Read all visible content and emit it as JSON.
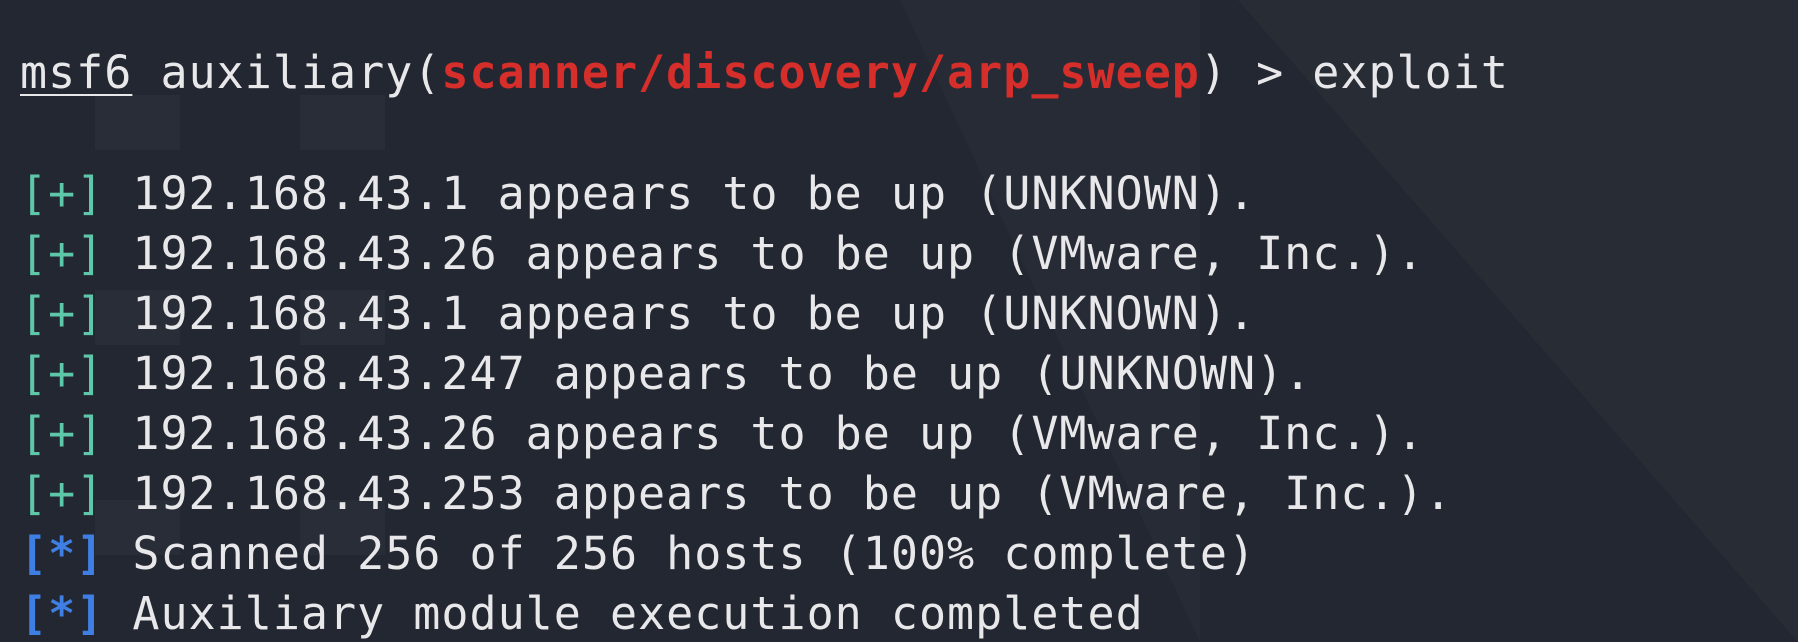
{
  "terminal": {
    "background_color": "#232731",
    "text_color": "#e8e8ea",
    "module_color": "#d62e2a",
    "success_marker_color": "#5ec7a9",
    "status_marker_color": "#3f7fe3",
    "prompt": {
      "user": "msf6",
      "context": " auxiliary(",
      "module": "scanner/discovery/arp_sweep",
      "suffix": ") > ",
      "command": "exploit"
    },
    "lines": [
      {
        "marker": "[+]",
        "text": " 192.168.43.1 appears to be up (UNKNOWN)."
      },
      {
        "marker": "[+]",
        "text": " 192.168.43.26 appears to be up (VMware, Inc.)."
      },
      {
        "marker": "[+]",
        "text": " 192.168.43.1 appears to be up (UNKNOWN)."
      },
      {
        "marker": "[+]",
        "text": " 192.168.43.247 appears to be up (UNKNOWN)."
      },
      {
        "marker": "[+]",
        "text": " 192.168.43.26 appears to be up (VMware, Inc.)."
      },
      {
        "marker": "[+]",
        "text": " 192.168.43.253 appears to be up (VMware, Inc.)."
      },
      {
        "marker": "[*]",
        "text": " Scanned 256 of 256 hosts (100% complete)"
      },
      {
        "marker": "[*]",
        "text": " Auxiliary module execution completed"
      }
    ]
  }
}
